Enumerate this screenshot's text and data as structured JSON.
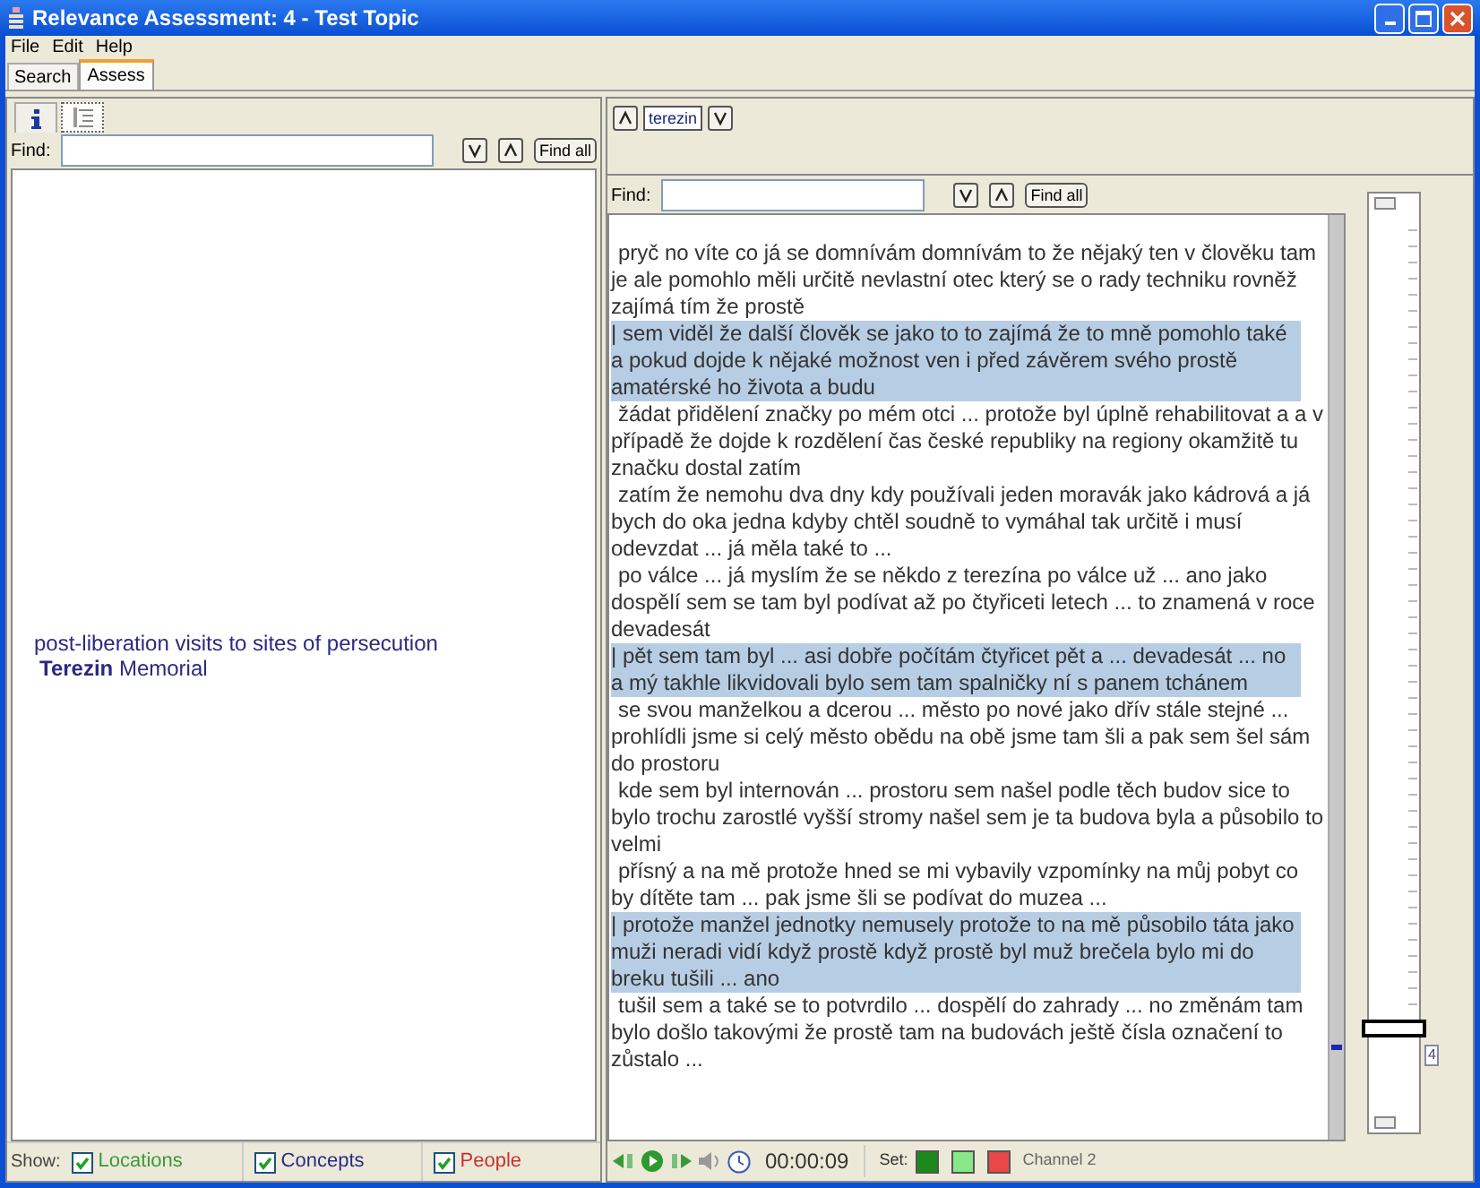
{
  "window": {
    "title": "Relevance Assessment: 4 - Test Topic"
  },
  "menu": [
    "File",
    "Edit",
    "Help"
  ],
  "tabs": [
    {
      "label": "Search",
      "selected": false
    },
    {
      "label": "Assess",
      "selected": true
    }
  ],
  "left_panel": {
    "view_tabs": [
      {
        "kind": "info",
        "selected": false
      },
      {
        "kind": "list",
        "selected": true
      }
    ],
    "find": {
      "label": "Find:",
      "find_all": "Find all"
    },
    "entries": [
      {
        "text": "post-liberation visits to sites of persecution"
      },
      {
        "text": "**Terezin** Memorial"
      }
    ],
    "show": {
      "label": "Show:",
      "filters": [
        {
          "label": "Locations",
          "checked": true,
          "color": "#3a9a3a"
        },
        {
          "label": "Concepts",
          "checked": true,
          "color": "#2a2a8a"
        },
        {
          "label": "People",
          "checked": true,
          "color": "#c83030"
        }
      ]
    }
  },
  "right_panel": {
    "term": "terezin",
    "find": {
      "label": "Find:",
      "find_all": "Find all"
    },
    "segments": [
      {
        "text": "pryč no víte co já se domnívám domnívám to že nějaký ten v člověku tam je ale pomohlo měli určitě nevlastní otec který se o rady techniku rovněž zajímá tím že prostě",
        "highlighted": false
      },
      {
        "text": "|  sem viděl že další člověk se jako to to zajímá že to mně pomohlo také a pokud dojde k nějaké možnost ven i před závěrem svého prostě amatérské ho života a budu",
        "highlighted": true
      },
      {
        "text": "žádat přidělení značky po mém otci ...  protože byl úplně rehabilitovat a a v případě že dojde k rozdělení čas české republiky na regiony okamžitě tu značku dostal zatím",
        "highlighted": false
      },
      {
        "text": "zatím že nemohu dva dny kdy používali jeden moravák jako kádrová a já bych do oka jedna kdyby chtěl soudně to vymáhal tak určitě i musí odevzdat ...  já měla také to ...",
        "highlighted": false
      },
      {
        "text": "po válce ...  já myslím že se někdo z terezína po válce už ...  ano jako dospělí sem se tam byl podívat až po čtyřiceti letech ...  to znamená v roce devadesát",
        "highlighted": false
      },
      {
        "text": "|  pět sem tam byl ...  asi dobře počítám čtyřicet pět a ...  devadesát ...  no a mý takhle likvidovali bylo sem tam spalničky ní s panem tchánem",
        "highlighted": true
      },
      {
        "text": "se svou manželkou a dcerou ...  město po nové jako dřív stále stejné ...  prohlídli jsme si celý město obědu na obě jsme tam šli a pak sem šel sám do prostoru",
        "highlighted": false
      },
      {
        "text": "kde sem byl internován ...  prostoru sem našel podle těch budov sice to bylo trochu zarostlé vyšší stromy našel sem je ta budova byla a působilo to velmi",
        "highlighted": false
      },
      {
        "text": "přísný a na mě protože hned se mi vybavily vzpomínky na můj pobyt co by dítěte tam ...  pak jsme šli se podívat do muzea ...",
        "highlighted": false
      },
      {
        "text": "|  protože manžel jednotky nemusely protože to na mě působilo táta jako muži neradi vidí když prostě když prostě byl muž brečela bylo mi do breku tušili ...  ano",
        "highlighted": true
      },
      {
        "text": "tušil sem a také se to potvrdilo ...  dospělí do zahrady ...  no změnám tam bylo došlo takovými že prostě tam na budovách ještě čísla označení to zůstalo ...",
        "highlighted": false
      }
    ],
    "timeline": {
      "label": "4"
    },
    "player": {
      "time": "00:00:09",
      "set_label": "Set:",
      "set_colors": [
        {
          "color": "#1a8a1a"
        },
        {
          "color": "#88e888"
        },
        {
          "color": "#e84848"
        }
      ],
      "channel": "Channel 2"
    }
  }
}
